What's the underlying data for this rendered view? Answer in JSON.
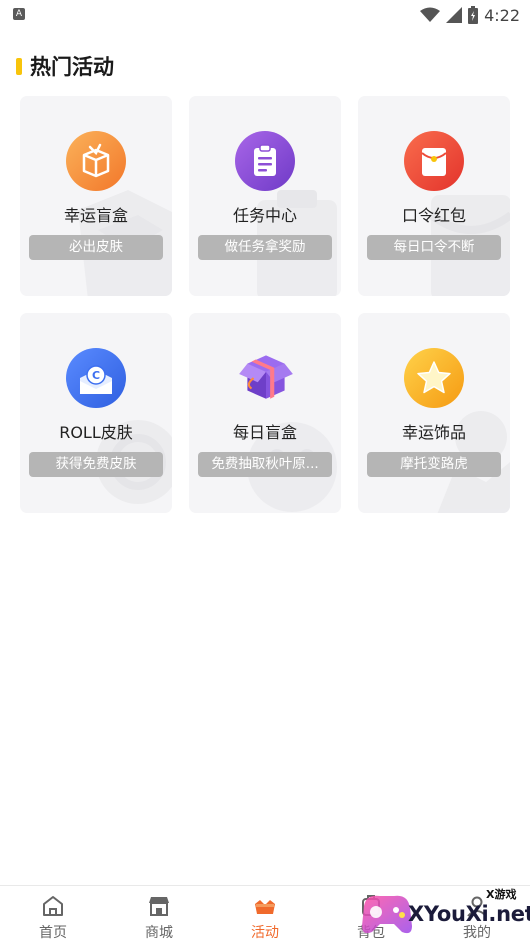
{
  "status_bar": {
    "app_badge": "A",
    "time": "4:22"
  },
  "section": {
    "title": "热门活动"
  },
  "cards": [
    {
      "name": "幸运盲盒",
      "tag": "必出皮肤",
      "icon": "orange-box-icon",
      "color": "#f7963a"
    },
    {
      "name": "任务中心",
      "tag": "做任务拿奖励",
      "icon": "purple-clipboard-icon",
      "color": "#8d4fd6"
    },
    {
      "name": "口令红包",
      "tag": "每日口令不断",
      "icon": "red-envelope-icon",
      "color": "#ee4b3a"
    },
    {
      "name": "ROLL皮肤",
      "tag": "获得免费皮肤",
      "icon": "blue-coin-envelope-icon",
      "color": "#3d6ff0"
    },
    {
      "name": "每日盲盒",
      "tag": "免费抽取秋叶原...",
      "icon": "gift-box-icon",
      "color": "#7a4fd0"
    },
    {
      "name": "幸运饰品",
      "tag": "摩托变路虎",
      "icon": "gold-star-icon",
      "color": "#f8b81a"
    }
  ],
  "tabbar": {
    "active": "活动",
    "items": [
      {
        "label": "首页",
        "icon": "home-icon"
      },
      {
        "label": "商城",
        "icon": "store-icon"
      },
      {
        "label": "活动",
        "icon": "crown-basket-icon"
      },
      {
        "label": "背包",
        "icon": "backpack-icon"
      },
      {
        "label": "我的",
        "icon": "profile-icon"
      }
    ]
  },
  "watermark": {
    "brand": "XYouXi.net",
    "tag": "X游戏"
  },
  "colors": {
    "accent": "#f06a2c",
    "title_bar": "#f8c40b",
    "card_bg": "#f5f5f7",
    "tag_bg": "#b5b5b5"
  }
}
